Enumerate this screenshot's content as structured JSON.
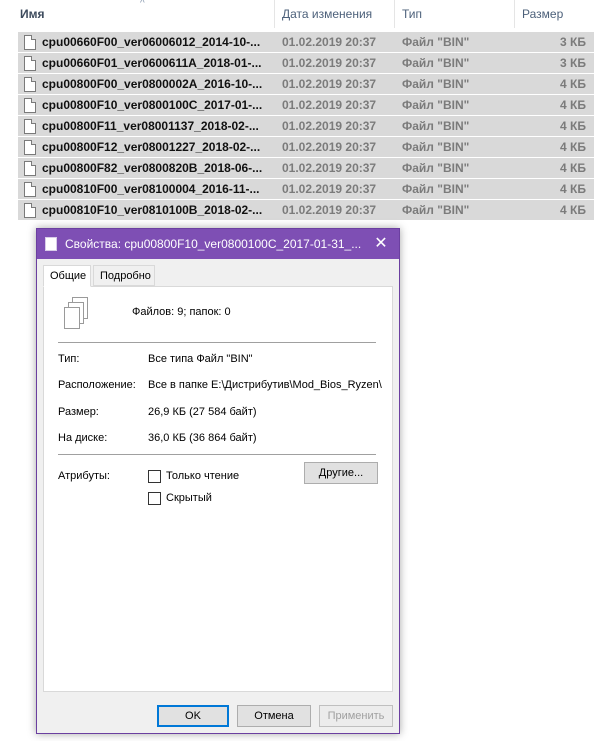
{
  "explorer": {
    "columns": {
      "name": "Имя",
      "date": "Дата изменения",
      "type": "Тип",
      "size": "Размер"
    },
    "sort_indicator": "^",
    "files": [
      {
        "name": "cpu00660F00_ver06006012_2014-10-...",
        "date": "01.02.2019 20:37",
        "type": "Файл \"BIN\"",
        "size": "3 КБ"
      },
      {
        "name": "cpu00660F01_ver0600611A_2018-01-...",
        "date": "01.02.2019 20:37",
        "type": "Файл \"BIN\"",
        "size": "3 КБ"
      },
      {
        "name": "cpu00800F00_ver0800002A_2016-10-...",
        "date": "01.02.2019 20:37",
        "type": "Файл \"BIN\"",
        "size": "4 КБ"
      },
      {
        "name": "cpu00800F10_ver0800100C_2017-01-...",
        "date": "01.02.2019 20:37",
        "type": "Файл \"BIN\"",
        "size": "4 КБ"
      },
      {
        "name": "cpu00800F11_ver08001137_2018-02-...",
        "date": "01.02.2019 20:37",
        "type": "Файл \"BIN\"",
        "size": "4 КБ"
      },
      {
        "name": "cpu00800F12_ver08001227_2018-02-...",
        "date": "01.02.2019 20:37",
        "type": "Файл \"BIN\"",
        "size": "4 КБ"
      },
      {
        "name": "cpu00800F82_ver0800820B_2018-06-...",
        "date": "01.02.2019 20:37",
        "type": "Файл \"BIN\"",
        "size": "4 КБ"
      },
      {
        "name": "cpu00810F00_ver08100004_2016-11-...",
        "date": "01.02.2019 20:37",
        "type": "Файл \"BIN\"",
        "size": "4 КБ"
      },
      {
        "name": "cpu00810F10_ver0810100B_2018-02-...",
        "date": "01.02.2019 20:37",
        "type": "Файл \"BIN\"",
        "size": "4 КБ"
      }
    ]
  },
  "dialog": {
    "title": "Свойства: cpu00800F10_ver0800100C_2017-01-31_...",
    "close_glyph": "✕",
    "tabs": [
      "Общие",
      "Подробно"
    ],
    "summary": "Файлов: 9; папок: 0",
    "props": {
      "type_label": "Тип:",
      "type_value": "Все типа Файл \"BIN\"",
      "location_label": "Расположение:",
      "location_value": "Все в папке E:\\Дистрибутив\\Mod_Bios_Ryzen\\",
      "size_label": "Размер:",
      "size_value": "26,9 КБ (27 584 байт)",
      "disk_label": "На диске:",
      "disk_value": "36,0 КБ (36 864 байт)"
    },
    "attributes": {
      "label": "Атрибуты:",
      "readonly": "Только чтение",
      "hidden": "Скрытый",
      "other_button": "Другие..."
    },
    "buttons": {
      "ok": "OK",
      "cancel": "Отмена",
      "apply": "Применить"
    }
  }
}
